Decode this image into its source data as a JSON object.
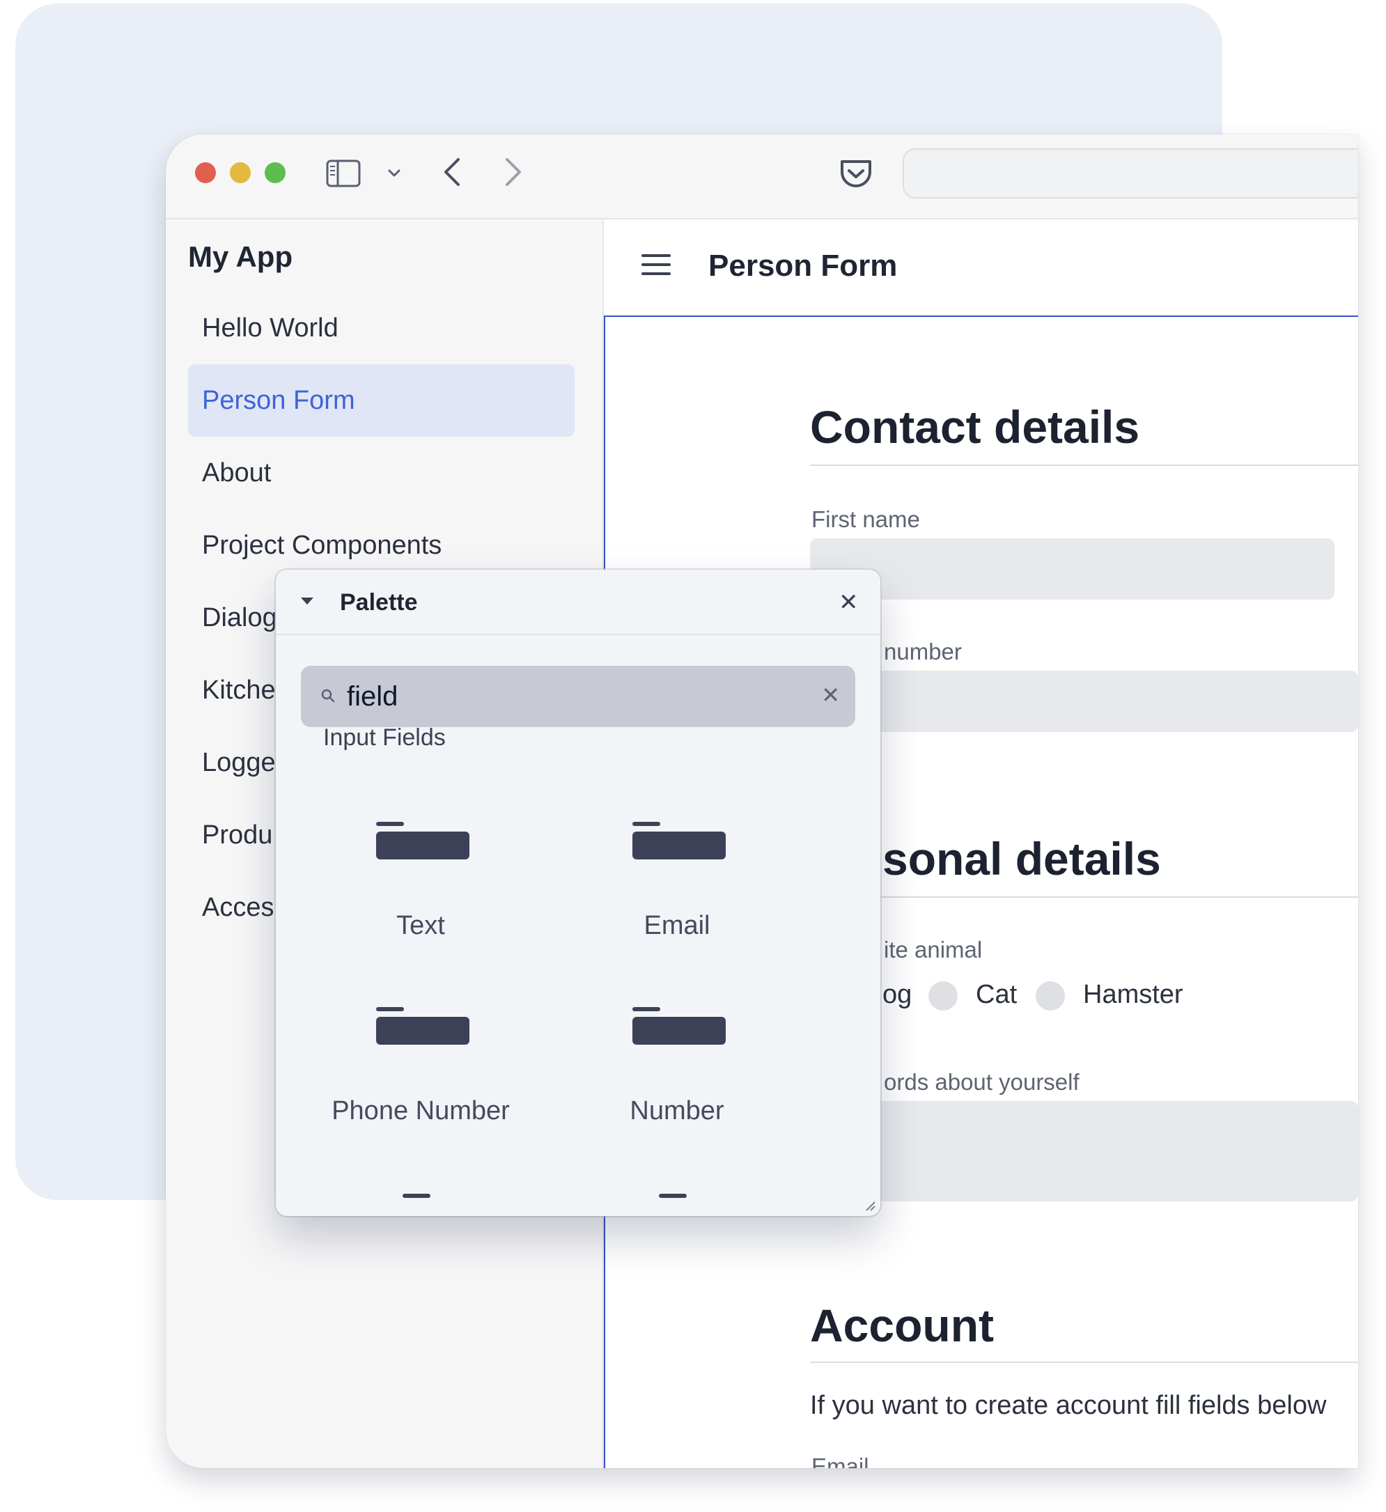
{
  "sidebar": {
    "app_title": "My App",
    "items": [
      {
        "label": "Hello World"
      },
      {
        "label": "Person Form",
        "active": true
      },
      {
        "label": "About"
      },
      {
        "label": "Project Components"
      },
      {
        "label": "Dialog"
      },
      {
        "label": "Kitche"
      },
      {
        "label": "Logge"
      },
      {
        "label": "Produ"
      },
      {
        "label": "Acces"
      }
    ]
  },
  "header": {
    "title": "Person Form"
  },
  "form": {
    "contact_title": "Contact details",
    "first_name_label": "First name",
    "phone_label": "number",
    "personal_title": "sonal details",
    "animal_label": "ite animal",
    "animal_options": [
      "og",
      "Cat",
      "Hamster"
    ],
    "about_label": "ords about yourself",
    "account_title": "Account",
    "account_text": "If you want to create account fill fields below",
    "email_label": "Email"
  },
  "palette": {
    "title": "Palette",
    "search_value": "field",
    "group_label": "Input Fields",
    "items": [
      {
        "label": "Text"
      },
      {
        "label": "Email"
      },
      {
        "label": "Phone Number"
      },
      {
        "label": "Number"
      }
    ]
  },
  "icons": {
    "traffic_lights": [
      "close-window-icon",
      "minimize-window-icon",
      "zoom-window-icon"
    ],
    "toolbar": [
      "sidebar-toggle-icon",
      "chevron-down-icon",
      "back-arrow-icon",
      "forward-arrow-icon",
      "pocket-icon"
    ],
    "hamburger": "hamburger-menu-icon",
    "search": "search-icon",
    "close": "close-icon"
  },
  "colors": {
    "accent": "#3f63d8",
    "active_bg": "#e0e6f6",
    "backdrop": "#e9eef7",
    "chip": "#3d4158"
  }
}
